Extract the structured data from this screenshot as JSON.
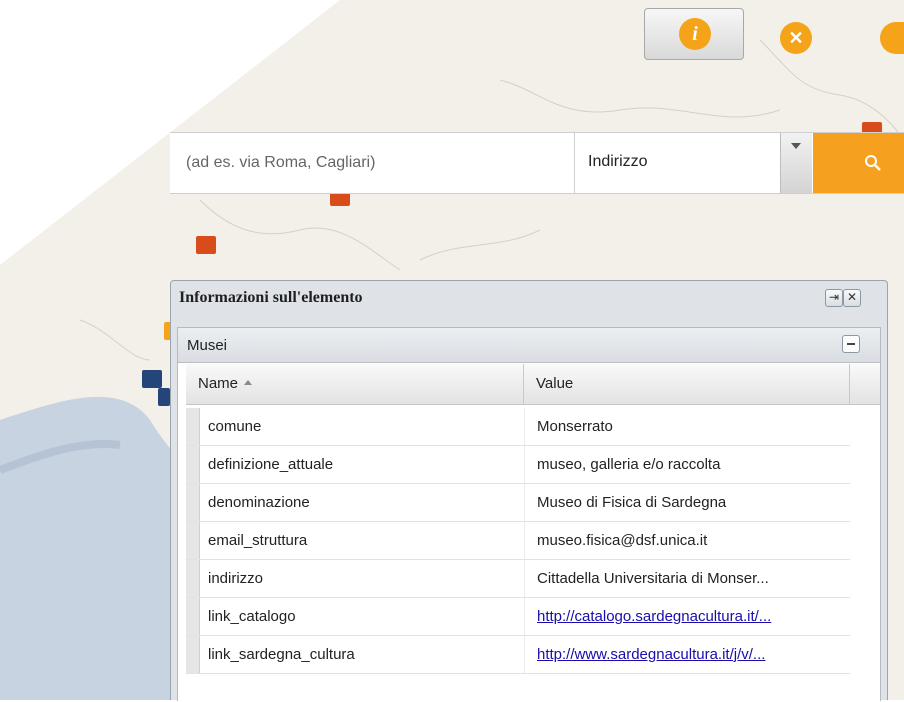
{
  "toolbar": {
    "info_icon": "info-icon",
    "clear_icon": "close-circle-icon",
    "zoom_icon": "zoom-icon",
    "accent": "#f5a41a"
  },
  "search": {
    "placeholder": "(ad es. via Roma, Cagliari)",
    "value": "",
    "type_selected": "Indirizzo",
    "submit_icon": "search-icon"
  },
  "panel": {
    "title": "Informazioni sull'elemento",
    "pin_icon": "pin-icon",
    "close_icon": "close-icon",
    "group": {
      "title": "Musei",
      "collapse_icon": "collapse-icon"
    },
    "grid": {
      "columns": {
        "name": "Name",
        "value": "Value"
      },
      "rows": [
        {
          "name": "comune",
          "value": "Monserrato",
          "link": false
        },
        {
          "name": "definizione_attuale",
          "value": "museo, galleria e/o raccolta",
          "link": false
        },
        {
          "name": "denominazione",
          "value": "Museo di Fisica di Sardegna",
          "link": false
        },
        {
          "name": "email_struttura",
          "value": "museo.fisica@dsf.unica.it",
          "link": false
        },
        {
          "name": "indirizzo",
          "value": "Cittadella Universitaria di Monser...",
          "link": false
        },
        {
          "name": "link_catalogo",
          "value": "http://catalogo.sardegnacultura.it/...",
          "link": true
        },
        {
          "name": "link_sardegna_cultura",
          "value": "http://www.sardegnacultura.it/j/v/...",
          "link": true
        }
      ]
    }
  }
}
